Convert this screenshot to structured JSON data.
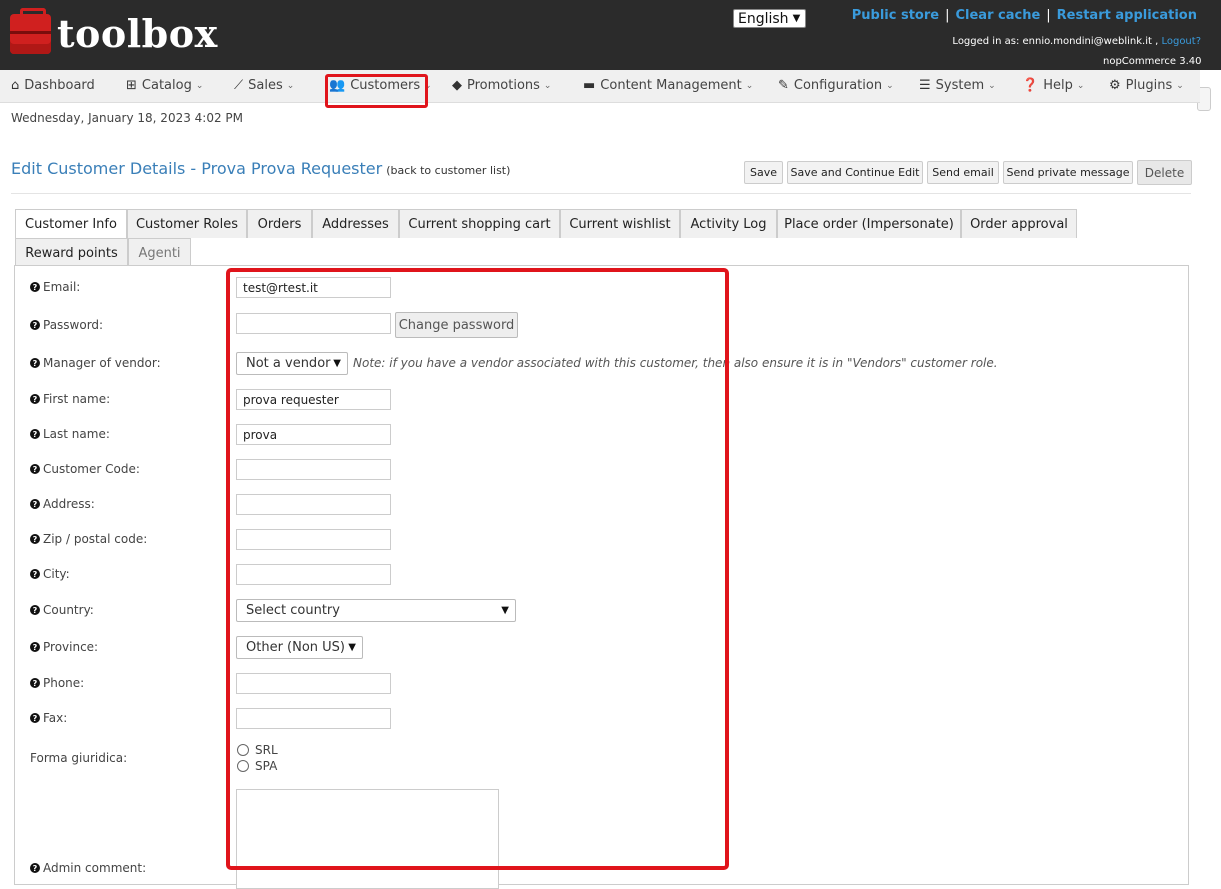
{
  "header": {
    "logo_text": "toolbox",
    "language": "English",
    "links": {
      "public_store": "Public store",
      "clear_cache": "Clear cache",
      "restart": "Restart application",
      "separator": "|"
    },
    "logged_in_prefix": "Logged in as: ennio.mondini@weblink.it ,",
    "logout": "Logout?",
    "version": "nopCommerce 3.40"
  },
  "nav": {
    "dashboard": "Dashboard",
    "catalog": "Catalog",
    "sales": "Sales",
    "customers": "Customers",
    "promotions": "Promotions",
    "content": "Content Management",
    "configuration": "Configuration",
    "system": "System",
    "help": "Help",
    "plugins": "Plugins"
  },
  "date": "Wednesday, January 18, 2023 4:02 PM",
  "page": {
    "title": "Edit Customer Details - Prova Prova Requester",
    "back": "(back to customer list)"
  },
  "actions": {
    "save": "Save",
    "save_continue": "Save and Continue Edit",
    "send_email": "Send email",
    "send_pm": "Send private message",
    "delete": "Delete"
  },
  "tabs": {
    "customer_info": "Customer Info",
    "customer_roles": "Customer Roles",
    "orders": "Orders",
    "addresses": "Addresses",
    "cart": "Current shopping cart",
    "wishlist": "Current wishlist",
    "activity": "Activity Log",
    "place_order": "Place order (Impersonate)",
    "approval": "Order approval",
    "reward": "Reward points",
    "agenti": "Agenti"
  },
  "form": {
    "email_label": "Email:",
    "email_value": "test@rtest.it",
    "password_label": "Password:",
    "change_password": "Change password",
    "vendor_label": "Manager of vendor:",
    "vendor_value": "Not a vendor",
    "vendor_note": "Note: if you have a vendor associated with this customer, then also ensure it is in \"Vendors\" customer role.",
    "first_name_label": "First name:",
    "first_name_value": "prova requester",
    "last_name_label": "Last name:",
    "last_name_value": "prova",
    "customer_code_label": "Customer Code:",
    "address_label": "Address:",
    "zip_label": "Zip / postal code:",
    "city_label": "City:",
    "country_label": "Country:",
    "country_value": "Select country",
    "province_label": "Province:",
    "province_value": "Other (Non US)",
    "phone_label": "Phone:",
    "fax_label": "Fax:",
    "forma_label": "Forma giuridica:",
    "forma_options": [
      "SRL",
      "SPA"
    ],
    "admin_comment_label": "Admin comment:",
    "help_glyph": "?"
  },
  "colors": {
    "header_bg": "#2b2b2b",
    "link": "#3a9bdc",
    "title": "#3a7fb8",
    "highlight": "#e0141b"
  }
}
